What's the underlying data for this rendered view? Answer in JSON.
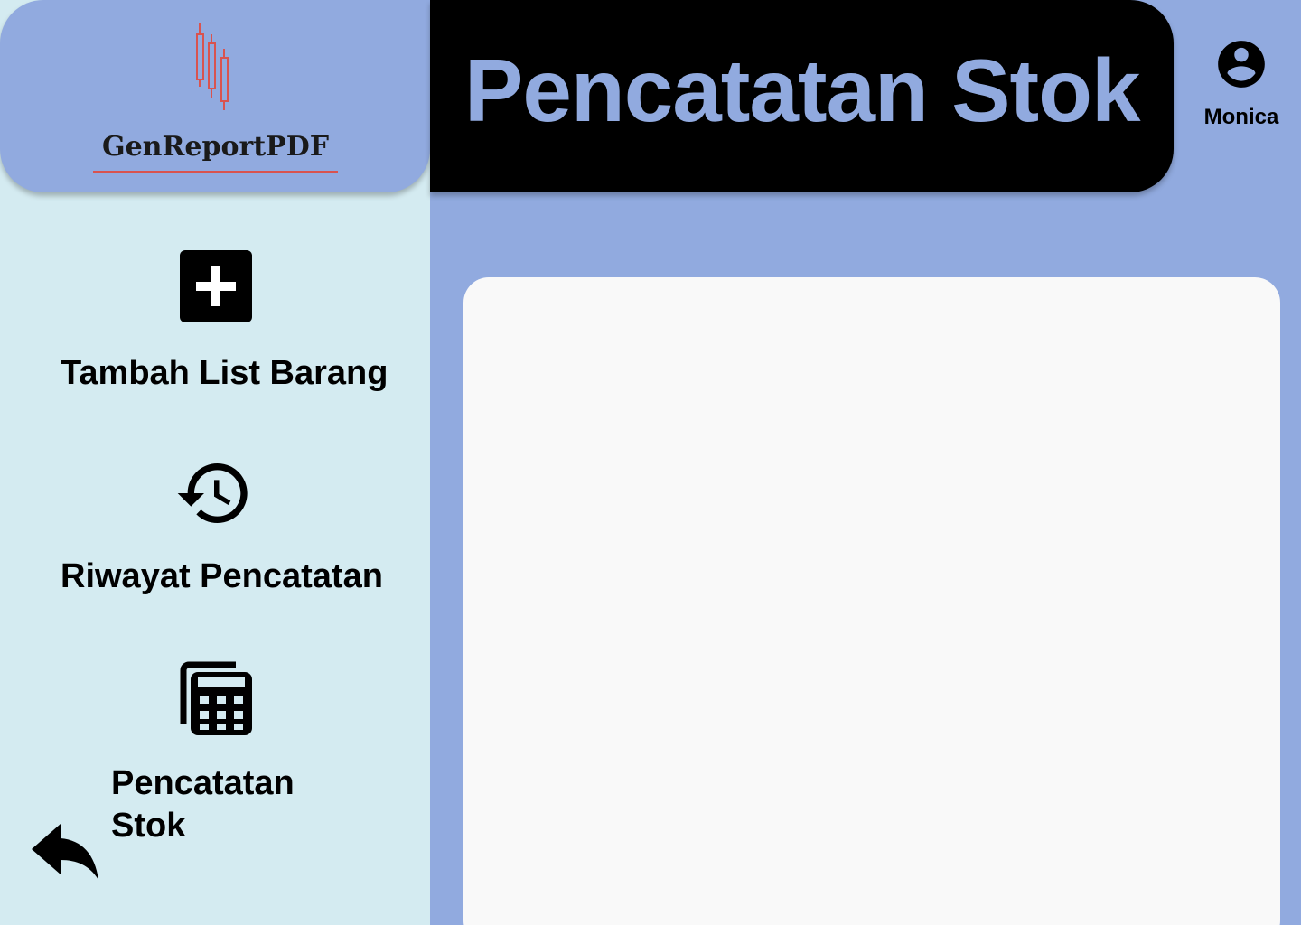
{
  "brand": {
    "name": "GenReportPDF",
    "logo_icon": "candlestick-chart-icon",
    "underline_color": "#d9534f"
  },
  "header": {
    "title": "Pencatatan Stok"
  },
  "user": {
    "name": "Monica",
    "icon": "account-circle-icon"
  },
  "sidebar": {
    "items": [
      {
        "label": "Tambah List Barang",
        "icon": "add-box-icon"
      },
      {
        "label": "Riwayat Pencatatan",
        "icon": "history-icon"
      },
      {
        "label_line1": "Pencatatan",
        "label_line2": "Stok",
        "icon": "calculator-stack-icon"
      }
    ],
    "back_icon": "reply-arrow-icon"
  },
  "colors": {
    "page_background": "#91aadf",
    "sidebar_background": "#d4ebf1",
    "header_background": "#000000",
    "header_text": "#91aadf",
    "panel_background": "#f9f9f9"
  }
}
